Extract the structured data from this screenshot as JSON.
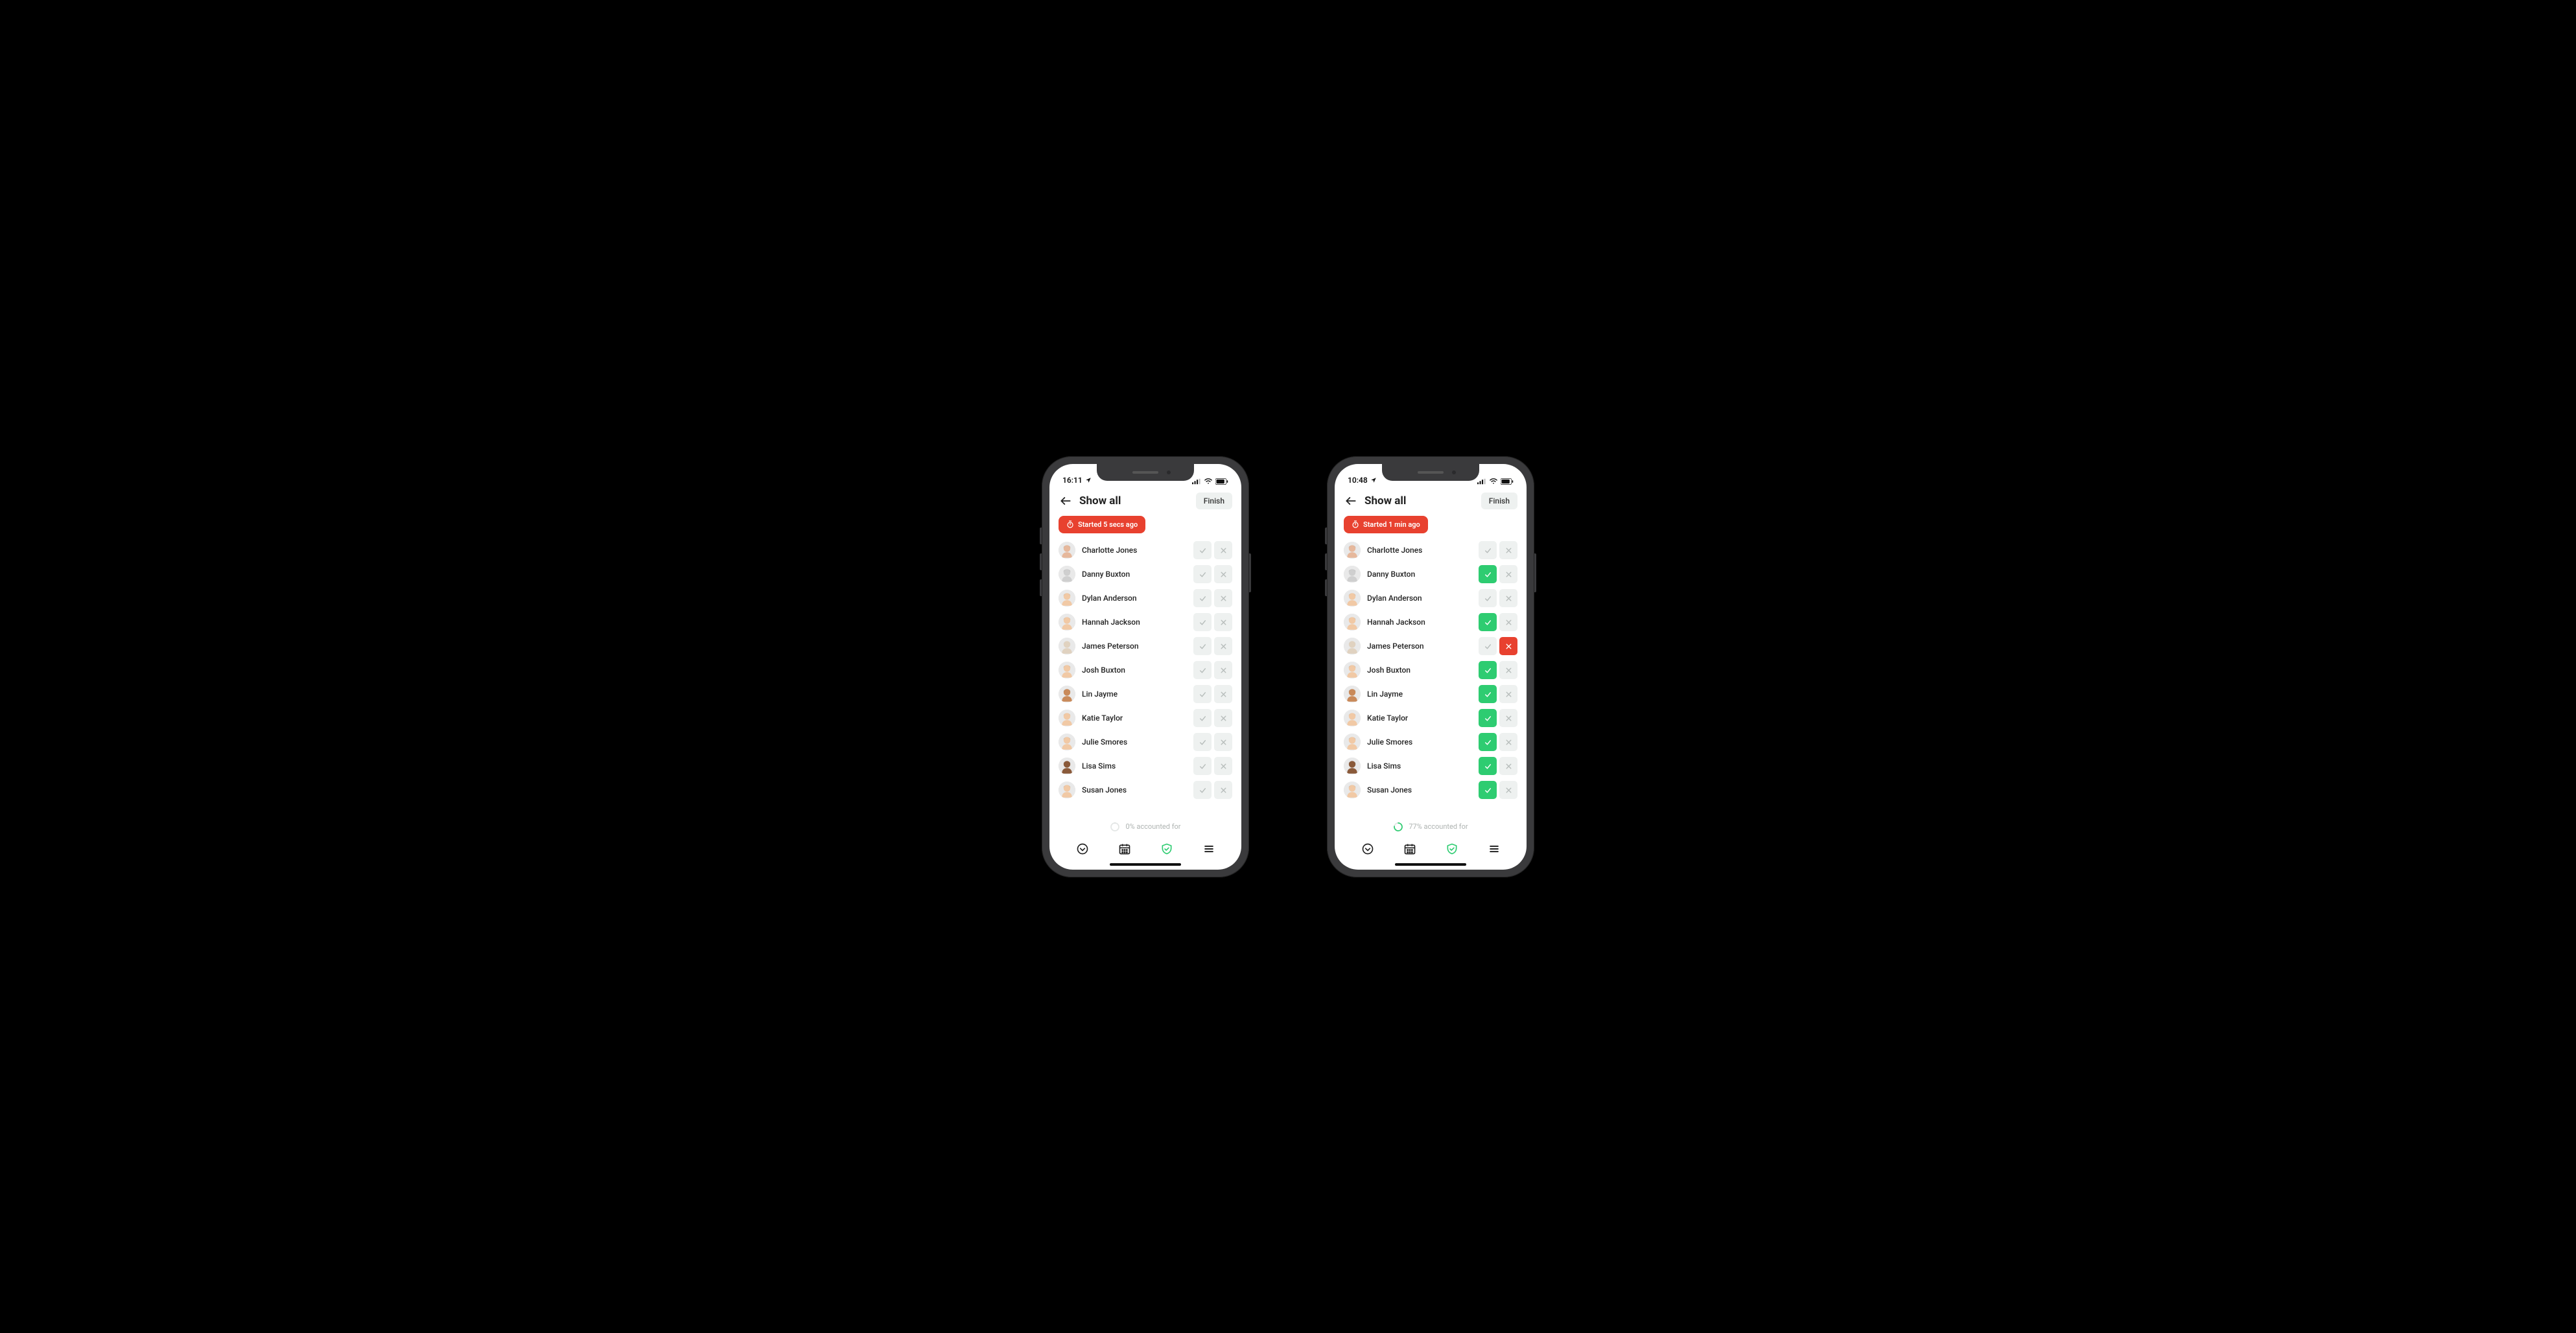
{
  "phones": [
    {
      "statusbar": {
        "time": "16:11"
      },
      "header": {
        "title": "Show all",
        "finish_label": "Finish"
      },
      "chip": {
        "label": "Started 5 secs ago"
      },
      "people": [
        {
          "name": "Charlotte Jones",
          "state": "none",
          "avatar": {
            "skin": "#e6b89c",
            "hair": "#3a2a1a"
          }
        },
        {
          "name": "Danny Buxton",
          "state": "none",
          "avatar": {
            "skin": "#cfcfcf",
            "hair": "#2a2a2a"
          }
        },
        {
          "name": "Dylan Anderson",
          "state": "none",
          "avatar": {
            "skin": "#f1c9a5",
            "hair": "#5a3a1a"
          }
        },
        {
          "name": "Hannah Jackson",
          "state": "none",
          "avatar": {
            "skin": "#f1c9a5",
            "hair": "#6a4a2a"
          }
        },
        {
          "name": "James Peterson",
          "state": "none",
          "avatar": {
            "skin": "#e0d2c0",
            "hair": "#bfbfbf"
          }
        },
        {
          "name": "Josh Buxton",
          "state": "none",
          "avatar": {
            "skin": "#f1c9a5",
            "hair": "#4a2a0a"
          }
        },
        {
          "name": "Lin Jayme",
          "state": "none",
          "avatar": {
            "skin": "#c98a5a",
            "hair": "#1a1a1a"
          }
        },
        {
          "name": "Katie Taylor",
          "state": "none",
          "avatar": {
            "skin": "#f1c9a5",
            "hair": "#8a5a2a"
          }
        },
        {
          "name": "Julie Smores",
          "state": "none",
          "avatar": {
            "skin": "#f1c9a5",
            "hair": "#5a3a1a"
          }
        },
        {
          "name": "Lisa Sims",
          "state": "none",
          "avatar": {
            "skin": "#8a5a3a",
            "hair": "#1a1a1a"
          }
        },
        {
          "name": "Susan Jones",
          "state": "none",
          "avatar": {
            "skin": "#f1c9a5",
            "hair": "#5a3a1a"
          }
        }
      ],
      "accounted": {
        "label": "0% accounted for",
        "percent": 0
      }
    },
    {
      "statusbar": {
        "time": "10:48"
      },
      "header": {
        "title": "Show all",
        "finish_label": "Finish"
      },
      "chip": {
        "label": "Started 1 min ago"
      },
      "people": [
        {
          "name": "Charlotte Jones",
          "state": "none",
          "avatar": {
            "skin": "#e6b89c",
            "hair": "#3a2a1a"
          }
        },
        {
          "name": "Danny Buxton",
          "state": "check",
          "avatar": {
            "skin": "#cfcfcf",
            "hair": "#2a2a2a"
          }
        },
        {
          "name": "Dylan Anderson",
          "state": "none",
          "avatar": {
            "skin": "#f1c9a5",
            "hair": "#5a3a1a"
          }
        },
        {
          "name": "Hannah Jackson",
          "state": "check",
          "avatar": {
            "skin": "#f1c9a5",
            "hair": "#6a4a2a"
          }
        },
        {
          "name": "James Peterson",
          "state": "cross",
          "avatar": {
            "skin": "#e0d2c0",
            "hair": "#bfbfbf"
          }
        },
        {
          "name": "Josh Buxton",
          "state": "check",
          "avatar": {
            "skin": "#f1c9a5",
            "hair": "#4a2a0a"
          }
        },
        {
          "name": "Lin Jayme",
          "state": "check",
          "avatar": {
            "skin": "#c98a5a",
            "hair": "#1a1a1a"
          }
        },
        {
          "name": "Katie Taylor",
          "state": "check",
          "avatar": {
            "skin": "#f1c9a5",
            "hair": "#8a5a2a"
          }
        },
        {
          "name": "Julie Smores",
          "state": "check",
          "avatar": {
            "skin": "#f1c9a5",
            "hair": "#5a3a1a"
          }
        },
        {
          "name": "Lisa Sims",
          "state": "check",
          "avatar": {
            "skin": "#8a5a3a",
            "hair": "#1a1a1a"
          }
        },
        {
          "name": "Susan Jones",
          "state": "check",
          "avatar": {
            "skin": "#f1c9a5",
            "hair": "#5a3a1a"
          }
        }
      ],
      "accounted": {
        "label": "77% accounted for",
        "percent": 77
      }
    }
  ],
  "colors": {
    "accent_green": "#2ecc71",
    "accent_red": "#e8412f",
    "neutral_btn": "#eef1f0"
  },
  "tabbar": {
    "items": [
      "clock-icon",
      "calendar-icon",
      "shield-icon",
      "menu-icon"
    ],
    "active_index": 2
  }
}
